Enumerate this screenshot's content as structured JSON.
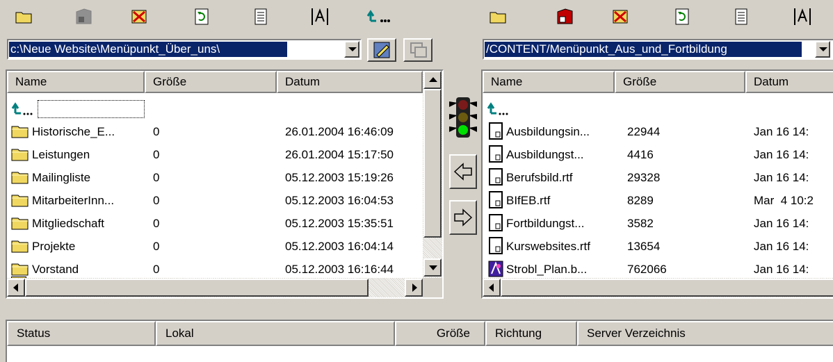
{
  "left_toolbar": {
    "icons": [
      "folder-icon",
      "save-disk-icon",
      "delete-icon",
      "refresh-icon",
      "text-file-icon",
      "rename-icon",
      "parent-directory-icon"
    ]
  },
  "right_toolbar": {
    "icons": [
      "folder-icon",
      "save-disk-icon",
      "delete-icon",
      "refresh-icon",
      "text-file-icon",
      "rename-icon"
    ]
  },
  "local": {
    "path": "c:\\Neue Website\\Menüpunkt_Über_uns\\",
    "columns": [
      "Name",
      "Größe",
      "Datum"
    ],
    "up_label": "",
    "rows": [
      {
        "name": "Historische_E...",
        "size": "0",
        "date": "26.01.2004 16:46:09"
      },
      {
        "name": "Leistungen",
        "size": "0",
        "date": "26.01.2004 15:17:50"
      },
      {
        "name": "Mailingliste",
        "size": "0",
        "date": "05.12.2003 15:19:26"
      },
      {
        "name": "MitarbeiterInn...",
        "size": "0",
        "date": "05.12.2003 16:04:53"
      },
      {
        "name": "Mitgliedschaft",
        "size": "0",
        "date": "05.12.2003 15:35:51"
      },
      {
        "name": "Projekte",
        "size": "0",
        "date": "05.12.2003 16:04:14"
      },
      {
        "name": "Vorstand",
        "size": "0",
        "date": "05.12.2003 16:16:44"
      }
    ]
  },
  "remote": {
    "path": "/CONTENT/Menüpunkt_Aus_und_Fortbildung",
    "columns": [
      "Name",
      "Größe",
      "Datum"
    ],
    "rows": [
      {
        "name": "Ausbildungsin...",
        "size": "22944",
        "date": "Jan 16 14:",
        "icon": "document-icon"
      },
      {
        "name": "Ausbildungst...",
        "size": "4416",
        "date": "Jan 16 14:",
        "icon": "document-icon"
      },
      {
        "name": "Berufsbild.rtf",
        "size": "29328",
        "date": "Jan 16 14:",
        "icon": "document-icon"
      },
      {
        "name": "BIfEB.rtf",
        "size": "8289",
        "date": "Mar  4 10:2",
        "icon": "document-icon"
      },
      {
        "name": "Fortbildungst...",
        "size": "3582",
        "date": "Jan 16 14:",
        "icon": "document-icon"
      },
      {
        "name": "Kurswebsites.rtf",
        "size": "13654",
        "date": "Jan 16 14:",
        "icon": "document-icon"
      },
      {
        "name": "Strobl_Plan.b...",
        "size": "762066",
        "date": "Jan 16 14:",
        "icon": "bitmap-icon"
      }
    ]
  },
  "middle": {
    "icons": [
      "traffic-light-icon",
      "transfer-left-icon",
      "transfer-right-icon"
    ]
  },
  "status": {
    "columns": [
      "Status",
      "Lokal",
      "Größe",
      "Richtung",
      "Server Verzeichnis"
    ]
  },
  "colors": {
    "face": "#d4d0c8",
    "selection": "#0a246a",
    "folder": "#f0d860"
  }
}
